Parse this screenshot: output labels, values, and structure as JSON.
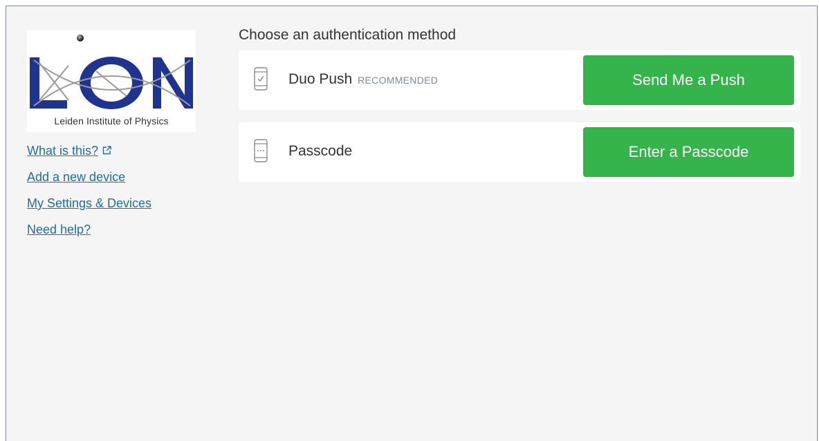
{
  "brand": {
    "logo_text": "Leiden Institute of Physics",
    "logo_icon": "lion-logo-icon",
    "logo_color": "#1f3391"
  },
  "links": {
    "what_is_this": "What is this?",
    "add_device": "Add a new device",
    "settings_devices": "My Settings & Devices",
    "need_help": "Need help?",
    "external_icon": "external-link-icon"
  },
  "prompt": {
    "title": "Choose an authentication method"
  },
  "methods": [
    {
      "label": "Duo Push",
      "badge": "RECOMMENDED",
      "icon": "phone-check-icon",
      "button": "Send Me a Push"
    },
    {
      "label": "Passcode",
      "badge": "",
      "icon": "phone-passcode-icon",
      "button": "Enter a Passcode"
    }
  ],
  "colors": {
    "button_green": "#34b44a",
    "link_blue": "#1d6ea5",
    "panel_background": "#f5f5f5"
  }
}
